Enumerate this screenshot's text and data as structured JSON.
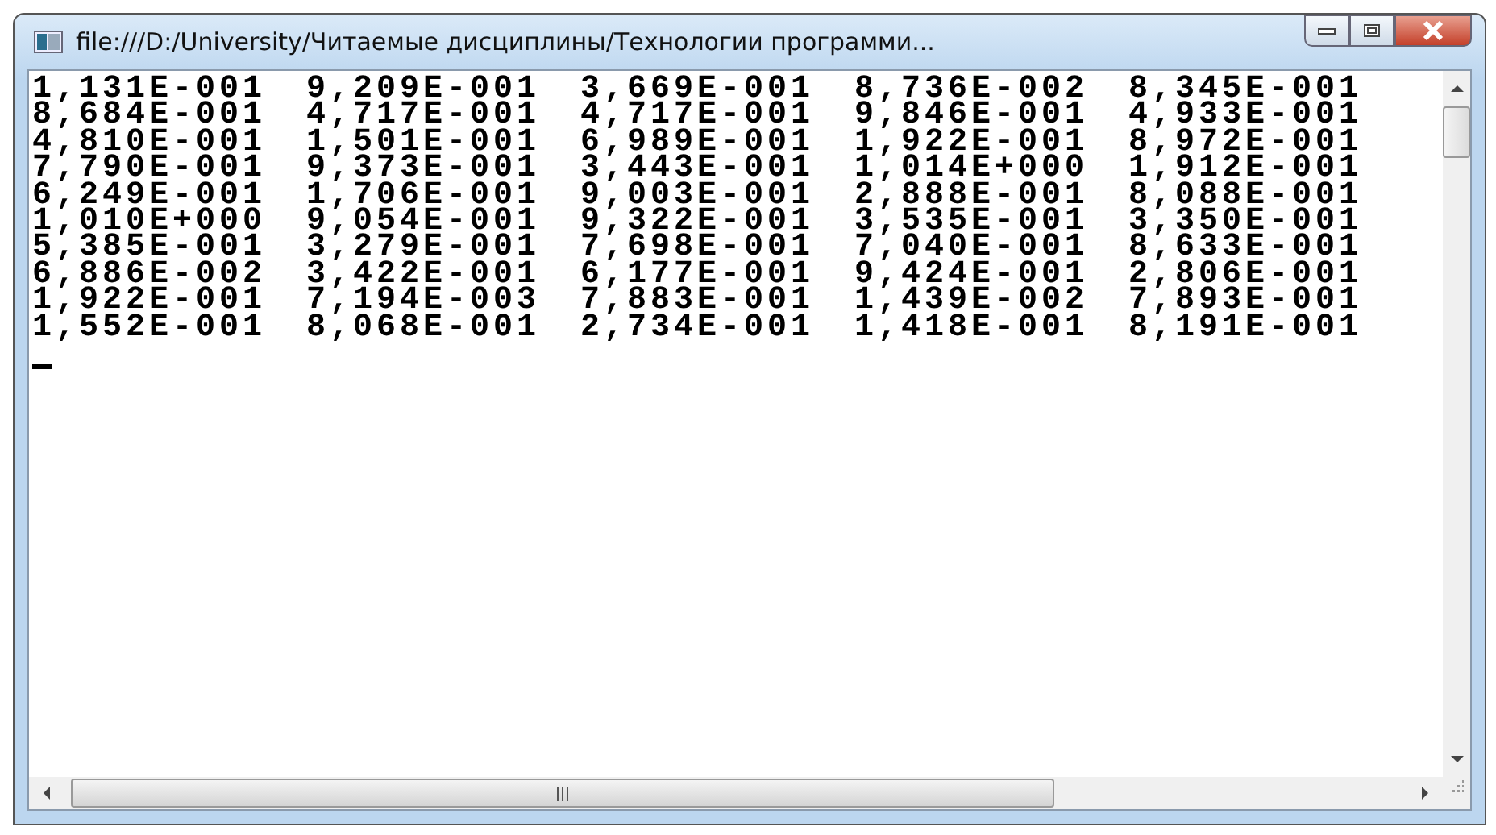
{
  "window": {
    "title": "file:///D:/University/Читаемые дисциплины/Технологии программи..."
  },
  "rows": [
    [
      "1,131E-001",
      "9,209E-001",
      "3,669E-001",
      "8,736E-002",
      "8,345E-001"
    ],
    [
      "8,684E-001",
      "4,717E-001",
      "4,717E-001",
      "9,846E-001",
      "4,933E-001"
    ],
    [
      "4,810E-001",
      "1,501E-001",
      "6,989E-001",
      "1,922E-001",
      "8,972E-001"
    ],
    [
      "7,790E-001",
      "9,373E-001",
      "3,443E-001",
      "1,014E+000",
      "1,912E-001"
    ],
    [
      "6,249E-001",
      "1,706E-001",
      "9,003E-001",
      "2,888E-001",
      "8,088E-001"
    ],
    [
      "1,010E+000",
      "9,054E-001",
      "9,322E-001",
      "3,535E-001",
      "3,350E-001"
    ],
    [
      "5,385E-001",
      "3,279E-001",
      "7,698E-001",
      "7,040E-001",
      "8,633E-001"
    ],
    [
      "6,886E-002",
      "3,422E-001",
      "6,177E-001",
      "9,424E-001",
      "2,806E-001"
    ],
    [
      "1,922E-001",
      "7,194E-003",
      "7,883E-001",
      "1,439E-002",
      "7,893E-001"
    ],
    [
      "1,552E-001",
      "8,068E-001",
      "2,734E-001",
      "1,418E-001",
      "8,191E-001"
    ]
  ]
}
